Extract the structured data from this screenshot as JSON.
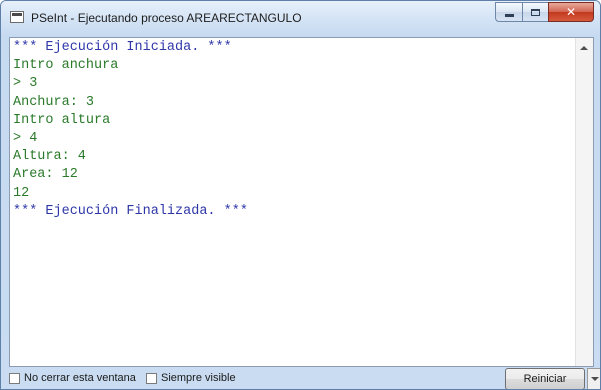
{
  "window": {
    "title": "PSeInt - Ejecutando proceso AREARECTANGULO"
  },
  "console": {
    "lines": [
      {
        "text": "*** Ejecución Iniciada. ***",
        "kind": "msg"
      },
      {
        "text": "Intro anchura",
        "kind": "out"
      },
      {
        "text": "> 3",
        "kind": "out"
      },
      {
        "text": "Anchura: 3",
        "kind": "out"
      },
      {
        "text": "Intro altura",
        "kind": "out"
      },
      {
        "text": "> 4",
        "kind": "out"
      },
      {
        "text": "Altura: 4",
        "kind": "out"
      },
      {
        "text": "Area: 12",
        "kind": "out"
      },
      {
        "text": "12",
        "kind": "out"
      },
      {
        "text": "*** Ejecución Finalizada. ***",
        "kind": "msg"
      }
    ]
  },
  "footer": {
    "keep_open_label": "No cerrar esta ventana",
    "always_visible_label": "Siempre visible",
    "restart_label": "Reiniciar",
    "keep_open_checked": false,
    "always_visible_checked": false
  },
  "colors": {
    "message_text": "#2f37a8",
    "output_text": "#2a7a2a"
  }
}
